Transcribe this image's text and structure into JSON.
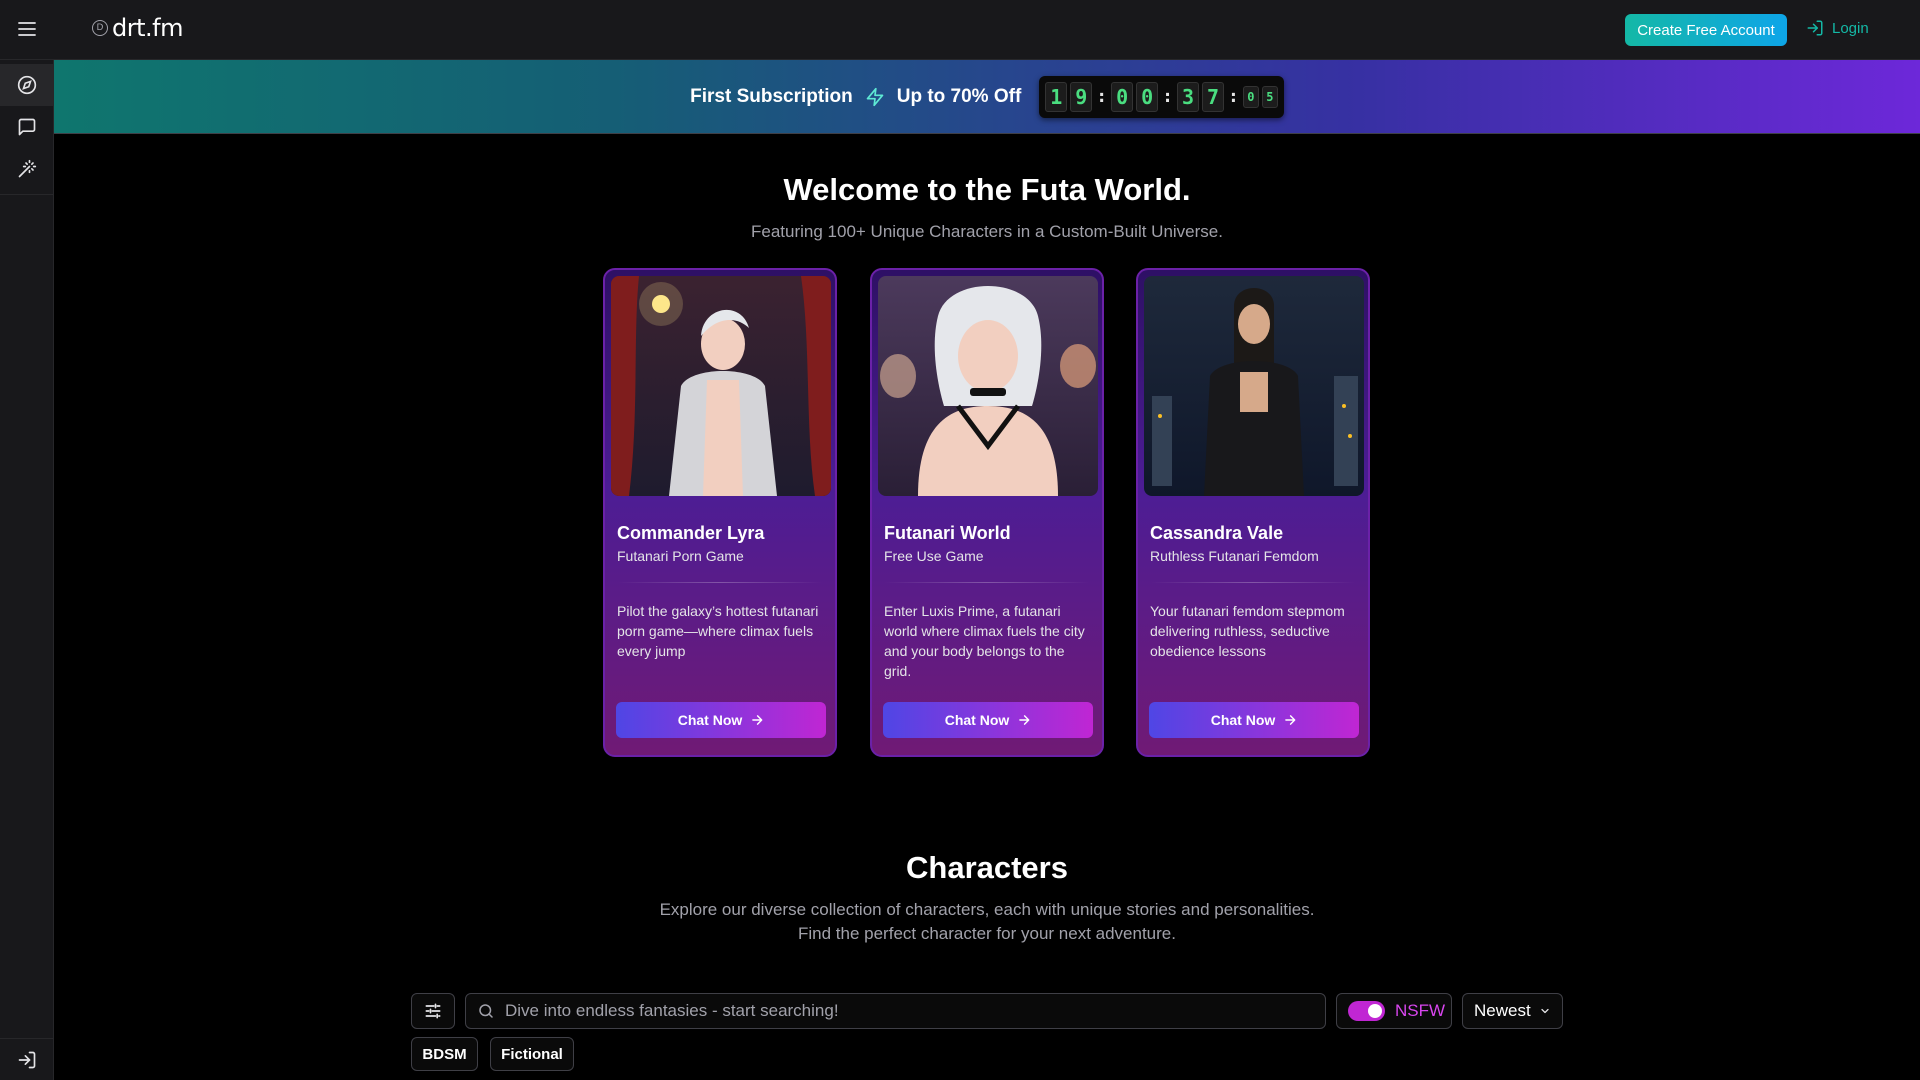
{
  "header": {
    "logo_mark": "D",
    "logo_text": "drt.fm",
    "create_account_label": "Create Free Account",
    "login_label": "Login"
  },
  "sidebar": {
    "items": [
      {
        "icon": "compass-icon",
        "active": true
      },
      {
        "icon": "chat-bubble-icon",
        "active": false
      },
      {
        "icon": "magic-wand-icon",
        "active": false
      }
    ],
    "bottom_icon": "login-icon"
  },
  "banner": {
    "title": "First Subscription",
    "offer": "Up to 70% Off",
    "countdown": {
      "hours": [
        "1",
        "9"
      ],
      "minutes": [
        "0",
        "0"
      ],
      "seconds": [
        "3",
        "7"
      ],
      "fraction": [
        "0",
        "5"
      ]
    },
    "colors": {
      "start": "#0f766e",
      "end": "#6d28d9"
    }
  },
  "hero": {
    "title": "Welcome to the Futa World.",
    "subtitle": "Featuring 100+ Unique Characters in a Custom-Built Universe."
  },
  "cards": [
    {
      "name": "Commander Lyra",
      "subtitle": "Futanari Porn Game",
      "description": "Pilot the galaxy’s hottest futanari porn game—where climax fuels every jump",
      "button_label": "Chat Now"
    },
    {
      "name": "Futanari World",
      "subtitle": "Free Use Game",
      "description": "Enter Luxis Prime, a futanari world where climax fuels the city and your body belongs to the grid.",
      "button_label": "Chat Now"
    },
    {
      "name": "Cassandra Vale",
      "subtitle": "Ruthless Futanari Femdom",
      "description": "Your futanari femdom stepmom delivering ruthless, seductive obedience lessons",
      "button_label": "Chat Now"
    }
  ],
  "characters": {
    "title": "Characters",
    "desc_line1": "Explore our diverse collection of characters, each with unique stories and personalities.",
    "desc_line2": "Find the perfect character for your next adventure.",
    "search_placeholder": "Dive into endless fantasies - start searching!",
    "nsfw_label": "NSFW",
    "nsfw_enabled": true,
    "sort_value": "Newest",
    "tags": [
      "BDSM",
      "Fictional"
    ]
  },
  "accent_colors": {
    "teal": "#14b8a6",
    "magenta": "#c026d3",
    "indigo": "#4f46e5",
    "timer_green": "#4ade80"
  }
}
